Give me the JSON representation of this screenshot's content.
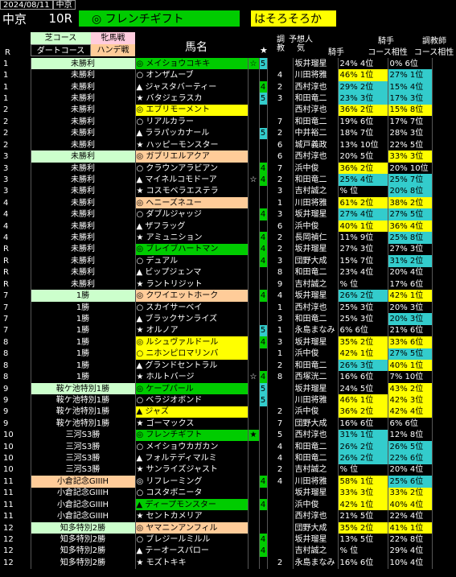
{
  "header": {
    "date": "2024/08/11",
    "venue_tab": "中京",
    "venue": "中京",
    "race": "10R",
    "race_title": "◎ フレンチギフト",
    "horse_name": "はそろそろか"
  },
  "columns": {
    "turf": "芝コース",
    "dirt": "ダートコース",
    "female": "牝馬戦",
    "handicap": "ハンデ戦",
    "name": "馬名",
    "star": "★",
    "train": "調教",
    "predict": "予想人気",
    "jockey": "騎手",
    "jockey_stat1": "騎手",
    "jockey_stat2": "コース相性",
    "trainer_stat1": "調教師",
    "trainer_stat2": "コース相性",
    "r": "R"
  },
  "colors": {
    "turf": "#ccffcc",
    "female": "#ffccdd",
    "handicap": "#ffcc99",
    "green": "#00cc00",
    "yellow": "#ffff00",
    "cyan": "#33cccc"
  },
  "rows": [
    {
      "r": "1",
      "cls": "未勝利",
      "clsc": "turf",
      "mark": "◎",
      "name": "メイショウコキキ",
      "nc": "green",
      "star": "☆",
      "train": "5",
      "tc": "b",
      "pred": "",
      "jockey": "坂井瑠星",
      "js": "24%",
      "jsp": "4位",
      "jsc": "none",
      "ts": "0%",
      "tsp": "6位",
      "tsc": "none"
    },
    {
      "r": "1",
      "cls": "未勝利",
      "clsc": "dirt",
      "mark": "○",
      "name": "オンザムーブ",
      "nc": "none",
      "star": "",
      "train": "",
      "tc": "",
      "pred": "4",
      "jockey": "川田将雅",
      "js": "46%",
      "jsp": "1位",
      "jsc": "yellow",
      "ts": "27%",
      "tsp": "1位",
      "tsc": "cyan"
    },
    {
      "r": "1",
      "cls": "未勝利",
      "clsc": "dirt",
      "mark": "▲",
      "name": "ジャスタバーティー",
      "nc": "none",
      "star": "",
      "train": "4",
      "tc": "g",
      "pred": "2",
      "jockey": "西村淳也",
      "js": "29%",
      "jsp": "2位",
      "jsc": "cyan",
      "ts": "15%",
      "tsp": "4位",
      "tsc": "cyan"
    },
    {
      "r": "1",
      "cls": "未勝利",
      "clsc": "dirt",
      "mark": "★",
      "name": "バタジェラスカ",
      "nc": "none",
      "star": "",
      "train": "5",
      "tc": "b",
      "pred": "3",
      "jockey": "和田竜二",
      "js": "23%",
      "jsp": "3位",
      "jsc": "cyan",
      "ts": "17%",
      "tsp": "3位",
      "tsc": "cyan"
    },
    {
      "r": "2",
      "cls": "未勝利",
      "clsc": "dirt",
      "mark": "◎",
      "name": "エブリモーメント",
      "nc": "yellow",
      "star": "",
      "train": "",
      "tc": "",
      "pred": "",
      "jockey": "西村淳也",
      "js": "36%",
      "jsp": "2位",
      "jsc": "yellow",
      "ts": "15%",
      "tsp": "8位",
      "tsc": "yellow"
    },
    {
      "r": "2",
      "cls": "未勝利",
      "clsc": "dirt",
      "mark": "○",
      "name": "リアルカラー",
      "nc": "none",
      "star": "",
      "train": "",
      "tc": "",
      "pred": "7",
      "jockey": "和田竜二",
      "js": "19%",
      "jsp": "6位",
      "jsc": "none",
      "ts": "17%",
      "tsp": "7位",
      "tsc": "none"
    },
    {
      "r": "2",
      "cls": "未勝利",
      "clsc": "dirt",
      "mark": "▲",
      "name": "ララパッカナール",
      "nc": "none",
      "star": "",
      "train": "5",
      "tc": "b",
      "pred": "2",
      "jockey": "中井裕二",
      "js": "18%",
      "jsp": "7位",
      "jsc": "none",
      "ts": "28%",
      "tsp": "3位",
      "tsc": "none"
    },
    {
      "r": "2",
      "cls": "未勝利",
      "clsc": "dirt",
      "mark": "★",
      "name": "ハッピーモンスター",
      "nc": "none",
      "star": "",
      "train": "",
      "tc": "",
      "pred": "6",
      "jockey": "城戸義政",
      "js": "13%",
      "jsp": "10位",
      "jsc": "none",
      "ts": "22%",
      "tsp": "5位",
      "tsc": "none"
    },
    {
      "r": "3",
      "cls": "未勝利",
      "clsc": "turf",
      "mark": "◎",
      "name": "ガブリエルアクア",
      "nc": "orange",
      "star": "",
      "train": "",
      "tc": "",
      "pred": "6",
      "jockey": "西村淳也",
      "js": "20%",
      "jsp": "5位",
      "jsc": "none",
      "ts": "33%",
      "tsp": "3位",
      "tsc": "yellow"
    },
    {
      "r": "3",
      "cls": "未勝利",
      "clsc": "dirt",
      "mark": "○",
      "name": "クラウンアラビアン",
      "nc": "none",
      "star": "",
      "train": "4",
      "tc": "g",
      "pred": "7",
      "jockey": "浜中俊",
      "js": "36%",
      "jsp": "2位",
      "jsc": "yellow",
      "ts": "20%",
      "tsp": "10位",
      "tsc": "none"
    },
    {
      "r": "3",
      "cls": "未勝利",
      "clsc": "dirt",
      "mark": "▲",
      "name": "マイネルコモドーア",
      "nc": "none",
      "star": "☆",
      "train": "4",
      "tc": "g",
      "pred": "2",
      "jockey": "和田竜二",
      "js": "25%",
      "jsp": "4位",
      "jsc": "cyan",
      "ts": "25%",
      "tsp": "7位",
      "tsc": "cyan"
    },
    {
      "r": "3",
      "cls": "未勝利",
      "clsc": "dirt",
      "mark": "★",
      "name": "コスモベラエステラ",
      "nc": "none",
      "star": "",
      "train": "",
      "tc": "",
      "pred": "3",
      "jockey": "吉村誠之",
      "js": "%",
      "jsp": "位",
      "jsc": "none",
      "ts": "20%",
      "tsp": "8位",
      "tsc": "cyan"
    },
    {
      "r": "4",
      "cls": "未勝利",
      "clsc": "dirt",
      "mark": "◎",
      "name": "ヘニーズネユー",
      "nc": "orange",
      "star": "",
      "train": "",
      "tc": "",
      "pred": "1",
      "jockey": "川田将雅",
      "js": "61%",
      "jsp": "2位",
      "jsc": "yellow",
      "ts": "38%",
      "tsp": "2位",
      "tsc": "yellow"
    },
    {
      "r": "4",
      "cls": "未勝利",
      "clsc": "dirt",
      "mark": "○",
      "name": "ダブルジャッジ",
      "nc": "none",
      "star": "",
      "train": "4",
      "tc": "g",
      "pred": "3",
      "jockey": "坂井瑠星",
      "js": "27%",
      "jsp": "4位",
      "jsc": "cyan",
      "ts": "27%",
      "tsp": "5位",
      "tsc": "cyan"
    },
    {
      "r": "4",
      "cls": "未勝利",
      "clsc": "dirt",
      "mark": "▲",
      "name": "ザフラッグ",
      "nc": "none",
      "star": "",
      "train": "",
      "tc": "",
      "pred": "6",
      "jockey": "浜中俊",
      "js": "40%",
      "jsp": "1位",
      "jsc": "yellow",
      "ts": "36%",
      "tsp": "4位",
      "tsc": "yellow"
    },
    {
      "r": "4",
      "cls": "未勝利",
      "clsc": "dirt",
      "mark": "★",
      "name": "アミュニション",
      "nc": "none",
      "star": "",
      "train": "4",
      "tc": "g",
      "pred": "2",
      "jockey": "長岡禎仁",
      "js": "11%",
      "jsp": "9位",
      "jsc": "none",
      "ts": "25%",
      "tsp": "8位",
      "tsc": "cyan"
    },
    {
      "r": "R",
      "cls": "未勝利",
      "clsc": "dirt",
      "mark": "◎",
      "name": "ブレイブハートマン",
      "nc": "green",
      "star": "",
      "train": "4",
      "tc": "g",
      "pred": "2",
      "jockey": "坂井瑠星",
      "js": "27%",
      "jsp": "3位",
      "jsc": "none",
      "ts": "27%",
      "tsp": "3位",
      "tsc": "none"
    },
    {
      "r": "R",
      "cls": "未勝利",
      "clsc": "dirt",
      "mark": "○",
      "name": "デュアル",
      "nc": "none",
      "star": "",
      "train": "4",
      "tc": "g",
      "pred": "3",
      "jockey": "団野大成",
      "js": "15%",
      "jsp": "7位",
      "jsc": "none",
      "ts": "31%",
      "tsp": "2位",
      "tsc": "cyan"
    },
    {
      "r": "R",
      "cls": "未勝利",
      "clsc": "dirt",
      "mark": "▲",
      "name": "ビップジェンマ",
      "nc": "none",
      "star": "",
      "train": "",
      "tc": "",
      "pred": "8",
      "jockey": "和田竜二",
      "js": "23%",
      "jsp": "4位",
      "jsc": "none",
      "ts": "20%",
      "tsp": "4位",
      "tsc": "none"
    },
    {
      "r": "R",
      "cls": "未勝利",
      "clsc": "dirt",
      "mark": "★",
      "name": "ラントリジット",
      "nc": "none",
      "star": "",
      "train": "",
      "tc": "",
      "pred": "9",
      "jockey": "吉村誠之",
      "js": "%",
      "jsp": "位",
      "jsc": "none",
      "ts": "17%",
      "tsp": "6位",
      "tsc": "none"
    },
    {
      "r": "7",
      "cls": "1勝",
      "clsc": "turf",
      "mark": "◎",
      "name": "クワイエットホーク",
      "nc": "orange",
      "star": "",
      "train": "4",
      "tc": "g",
      "pred": "4",
      "jockey": "坂井瑠星",
      "js": "26%",
      "jsp": "2位",
      "jsc": "cyan",
      "ts": "42%",
      "tsp": "1位",
      "tsc": "yellow"
    },
    {
      "r": "7",
      "cls": "1勝",
      "clsc": "dirt",
      "mark": "○",
      "name": "スカイサーベイ",
      "nc": "none",
      "star": "",
      "train": "",
      "tc": "",
      "pred": "1",
      "jockey": "西村淳也",
      "js": "25%",
      "jsp": "3位",
      "jsc": "none",
      "ts": "20%",
      "tsp": "3位",
      "tsc": "none"
    },
    {
      "r": "7",
      "cls": "1勝",
      "clsc": "dirt",
      "mark": "▲",
      "name": "ブラックサンライズ",
      "nc": "none",
      "star": "",
      "train": "",
      "tc": "",
      "pred": "3",
      "jockey": "和田竜二",
      "js": "25%",
      "jsp": "3位",
      "jsc": "none",
      "ts": "20%",
      "tsp": "3位",
      "tsc": "cyan"
    },
    {
      "r": "7",
      "cls": "1勝",
      "clsc": "dirt",
      "mark": "★",
      "name": "オルノア",
      "nc": "none",
      "star": "",
      "train": "5",
      "tc": "b",
      "pred": "1",
      "jockey": "永島まなみ",
      "js": "6%",
      "jsp": "6位",
      "jsc": "none",
      "ts": "21%",
      "tsp": "6位",
      "tsc": "none"
    },
    {
      "r": "8",
      "cls": "1勝",
      "clsc": "dirt",
      "mark": "◎",
      "name": "ルシュヴァルドール",
      "nc": "yellow",
      "star": "",
      "train": "4",
      "tc": "g",
      "pred": "3",
      "jockey": "坂井瑠星",
      "js": "35%",
      "jsp": "2位",
      "jsc": "yellow",
      "ts": "33%",
      "tsp": "6位",
      "tsc": "yellow"
    },
    {
      "r": "8",
      "cls": "1勝",
      "clsc": "dirt",
      "mark": "○",
      "name": "ニホンピロマリンバ",
      "nc": "yellow",
      "star": "",
      "train": "",
      "tc": "",
      "pred": "1",
      "jockey": "浜中俊",
      "js": "42%",
      "jsp": "1位",
      "jsc": "yellow",
      "ts": "27%",
      "tsp": "5位",
      "tsc": "cyan"
    },
    {
      "r": "8",
      "cls": "1勝",
      "clsc": "dirt",
      "mark": "▲",
      "name": "グランドセントラル",
      "nc": "none",
      "star": "",
      "train": "",
      "tc": "",
      "pred": "2",
      "jockey": "和田竜二",
      "js": "26%",
      "jsp": "3位",
      "jsc": "cyan",
      "ts": "40%",
      "tsp": "1位",
      "tsc": "yellow"
    },
    {
      "r": "8",
      "cls": "1勝",
      "clsc": "dirt",
      "mark": "★",
      "name": "ホルトバージ",
      "nc": "none",
      "star": "☆",
      "train": "4",
      "tc": "g",
      "pred": "8",
      "jockey": "西塚洸二",
      "js": "16%",
      "jsp": "6位",
      "jsc": "none",
      "ts": "7%",
      "tsp": "10位",
      "tsc": "none"
    },
    {
      "r": "9",
      "cls": "鞍ケ池特別1勝",
      "clsc": "turf",
      "mark": "◎",
      "name": "ケープパール",
      "nc": "green",
      "star": "",
      "train": "5",
      "tc": "b",
      "pred": "",
      "jockey": "坂井瑠星",
      "js": "24%",
      "jsp": "5位",
      "jsc": "none",
      "ts": "43%",
      "tsp": "2位",
      "tsc": "yellow"
    },
    {
      "r": "9",
      "cls": "鞍ケ池特別1勝",
      "clsc": "dirt",
      "mark": "○",
      "name": "ベラジオボンド",
      "nc": "none",
      "star": "",
      "train": "5",
      "tc": "b",
      "pred": "",
      "jockey": "川田将雅",
      "js": "46%",
      "jsp": "1位",
      "jsc": "yellow",
      "ts": "42%",
      "tsp": "3位",
      "tsc": "yellow"
    },
    {
      "r": "9",
      "cls": "鞍ケ池特別1勝",
      "clsc": "dirt",
      "mark": "▲",
      "name": "ジャズ",
      "nc": "yellow",
      "star": "",
      "train": "",
      "tc": "",
      "pred": "2",
      "jockey": "浜中俊",
      "js": "36%",
      "jsp": "2位",
      "jsc": "yellow",
      "ts": "42%",
      "tsp": "4位",
      "tsc": "yellow"
    },
    {
      "r": "9",
      "cls": "鞍ケ池特別1勝",
      "clsc": "dirt",
      "mark": "★",
      "name": "ゴーマックス",
      "nc": "none",
      "star": "",
      "train": "",
      "tc": "",
      "pred": "7",
      "jockey": "団野大成",
      "js": "16%",
      "jsp": "6位",
      "jsc": "none",
      "ts": "6%",
      "tsp": "6位",
      "tsc": "none"
    },
    {
      "r": "10",
      "cls": "三河S3勝",
      "clsc": "dirt",
      "mark": "◎",
      "name": "フレンチギフト",
      "nc": "green",
      "star": "★",
      "train": "",
      "tc": "",
      "pred": "5",
      "jockey": "西村淳也",
      "js": "31%",
      "jsp": "1位",
      "jsc": "cyan",
      "ts": "12%",
      "tsp": "8位",
      "tsc": "none"
    },
    {
      "r": "10",
      "cls": "三河S3勝",
      "clsc": "dirt",
      "mark": "○",
      "name": "メイショウカガカン",
      "nc": "none",
      "star": "",
      "train": "",
      "tc": "",
      "pred": "4",
      "jockey": "和田竜二",
      "js": "26%",
      "jsp": "2位",
      "jsc": "cyan",
      "ts": "26%",
      "tsp": "5位",
      "tsc": "cyan"
    },
    {
      "r": "10",
      "cls": "三河S3勝",
      "clsc": "dirt",
      "mark": "▲",
      "name": "フォルテディマルミ",
      "nc": "none",
      "star": "",
      "train": "",
      "tc": "",
      "pred": "4",
      "jockey": "和田竜二",
      "js": "26%",
      "jsp": "2位",
      "jsc": "cyan",
      "ts": "22%",
      "tsp": "6位",
      "tsc": "cyan"
    },
    {
      "r": "10",
      "cls": "三河S3勝",
      "clsc": "dirt",
      "mark": "★",
      "name": "サンライズジャスト",
      "nc": "none",
      "star": "",
      "train": "",
      "tc": "",
      "pred": "2",
      "jockey": "吉村誠之",
      "js": "%",
      "jsp": "位",
      "jsc": "none",
      "ts": "20%",
      "tsp": "4位",
      "tsc": "none"
    },
    {
      "r": "11",
      "cls": "小倉記念GIIIH",
      "clsc": "handi",
      "mark": "◎",
      "name": "リフレーミング",
      "nc": "none",
      "star": "",
      "train": "4",
      "tc": "g",
      "pred": "4",
      "jockey": "川田将雅",
      "js": "58%",
      "jsp": "1位",
      "jsc": "yellow",
      "ts": "25%",
      "tsp": "6位",
      "tsc": "cyan"
    },
    {
      "r": "11",
      "cls": "小倉記念GIIIH",
      "clsc": "dirt",
      "mark": "○",
      "name": "コスタボニータ",
      "nc": "none",
      "star": "",
      "train": "",
      "tc": "",
      "pred": "",
      "jockey": "坂井瑠星",
      "js": "33%",
      "jsp": "3位",
      "jsc": "yellow",
      "ts": "33%",
      "tsp": "2位",
      "tsc": "yellow"
    },
    {
      "r": "11",
      "cls": "小倉記念GIIIH",
      "clsc": "dirt",
      "mark": "▲",
      "name": "ディープモンスター",
      "nc": "green",
      "star": "",
      "train": "4",
      "tc": "g",
      "pred": "",
      "jockey": "浜中俊",
      "js": "42%",
      "jsp": "1位",
      "jsc": "yellow",
      "ts": "40%",
      "tsp": "4位",
      "tsc": "yellow"
    },
    {
      "r": "11",
      "cls": "小倉記念GIIIH",
      "clsc": "dirt",
      "mark": "★",
      "name": "セントカメリア",
      "nc": "none",
      "star": "",
      "train": "",
      "tc": "",
      "pred": "",
      "jockey": "西村淳也",
      "js": "21%",
      "jsp": "5位",
      "jsc": "none",
      "ts": "22%",
      "tsp": "4位",
      "tsc": "none"
    },
    {
      "r": "12",
      "cls": "知多特別2勝",
      "clsc": "turf",
      "mark": "◎",
      "name": "ヤマニンアンフィル",
      "nc": "orange",
      "star": "",
      "train": "",
      "tc": "",
      "pred": "",
      "jockey": "団野大成",
      "js": "35%",
      "jsp": "2位",
      "jsc": "yellow",
      "ts": "41%",
      "tsp": "1位",
      "tsc": "yellow"
    },
    {
      "r": "12",
      "cls": "知多特別2勝",
      "clsc": "dirt",
      "mark": "○",
      "name": "ブレジールミルル",
      "nc": "none",
      "star": "",
      "train": "4",
      "tc": "g",
      "pred": "",
      "jockey": "坂井瑠星",
      "js": "13%",
      "jsp": "5位",
      "jsc": "none",
      "ts": "22%",
      "tsp": "8位",
      "tsc": "none"
    },
    {
      "r": "12",
      "cls": "知多特別2勝",
      "clsc": "dirt",
      "mark": "▲",
      "name": "テーオースパロー",
      "nc": "none",
      "star": "",
      "train": "4",
      "tc": "g",
      "pred": "",
      "jockey": "吉村誠之",
      "js": "%",
      "jsp": "位",
      "jsc": "none",
      "ts": "29%",
      "tsp": "4位",
      "tsc": "none"
    },
    {
      "r": "12",
      "cls": "知多特別2勝",
      "clsc": "dirt",
      "mark": "★",
      "name": "モズトキキ",
      "nc": "none",
      "star": "",
      "train": "",
      "tc": "",
      "pred": "2",
      "jockey": "永島まなみ",
      "js": "16%",
      "jsp": "6位",
      "jsc": "none",
      "ts": "10%",
      "tsp": "4位",
      "tsc": "none"
    }
  ]
}
